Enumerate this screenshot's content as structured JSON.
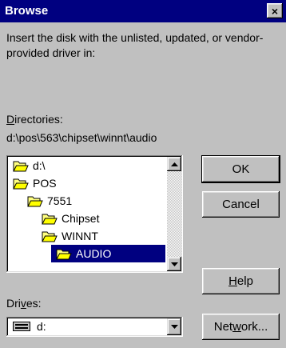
{
  "window": {
    "title": "Browse",
    "close_glyph": "×"
  },
  "message": "Insert the disk with the unlisted, updated, or vendor-provided driver in:",
  "directories": {
    "label_prefix": "",
    "label_accel": "D",
    "label_rest": "irectories:",
    "path": "d:\\pos\\563\\chipset\\winnt\\audio"
  },
  "tree": [
    {
      "label": "d:\\",
      "selected": false
    },
    {
      "label": "POS",
      "selected": false
    },
    {
      "label": "7551",
      "selected": false
    },
    {
      "label": "Chipset",
      "selected": false
    },
    {
      "label": "WINNT",
      "selected": false
    },
    {
      "label": "AUDIO",
      "selected": true
    }
  ],
  "buttons": {
    "ok": "OK",
    "cancel": "Cancel",
    "help_accel": "H",
    "help_rest": "elp",
    "network_pre": "Net",
    "network_accel": "w",
    "network_post": "ork..."
  },
  "drives": {
    "label_pre": "Dri",
    "label_accel": "v",
    "label_post": "es:",
    "value": "d:"
  },
  "icons": {
    "folder": "folder-icon",
    "open_folder": "open-folder-icon",
    "drive": "drive-icon"
  }
}
